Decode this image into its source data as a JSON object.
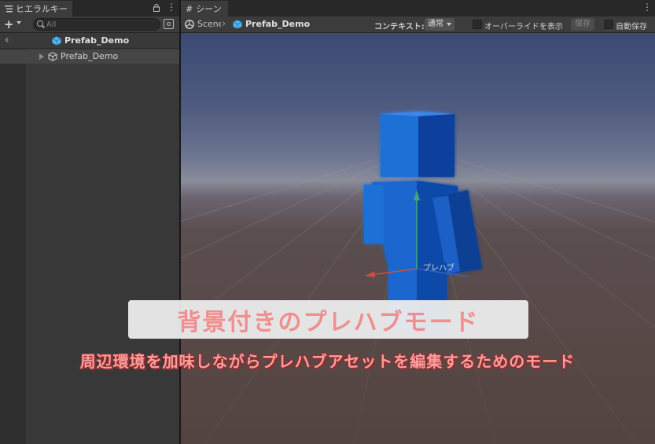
{
  "hierarchy": {
    "tab_label": "ヒエラルキー",
    "search_placeholder": "All",
    "prefab_title": "Prefab_Demo",
    "items": [
      {
        "label": "Prefab_Demo"
      }
    ]
  },
  "scene": {
    "tab_label": "シーン",
    "breadcrumb": [
      "Scene",
      "Prefab_Demo"
    ],
    "context_label": "コンテキスト:",
    "context_value": "通常",
    "override_label": "オーバーライドを表示",
    "save_label": "保存",
    "autosave_label": "自動保存",
    "pivot_label": "プレハブ"
  },
  "overlay": {
    "title": "背景付きのプレハブモード",
    "subtitle": "周辺環境を加味しながらプレハブアセットを編集するためのモード"
  },
  "colors": {
    "editor_panel": "#383838",
    "accent_prefab": "#4cb5f5",
    "title_text": "#ef8f8f",
    "subtitle_text": "#ff9c9c"
  }
}
